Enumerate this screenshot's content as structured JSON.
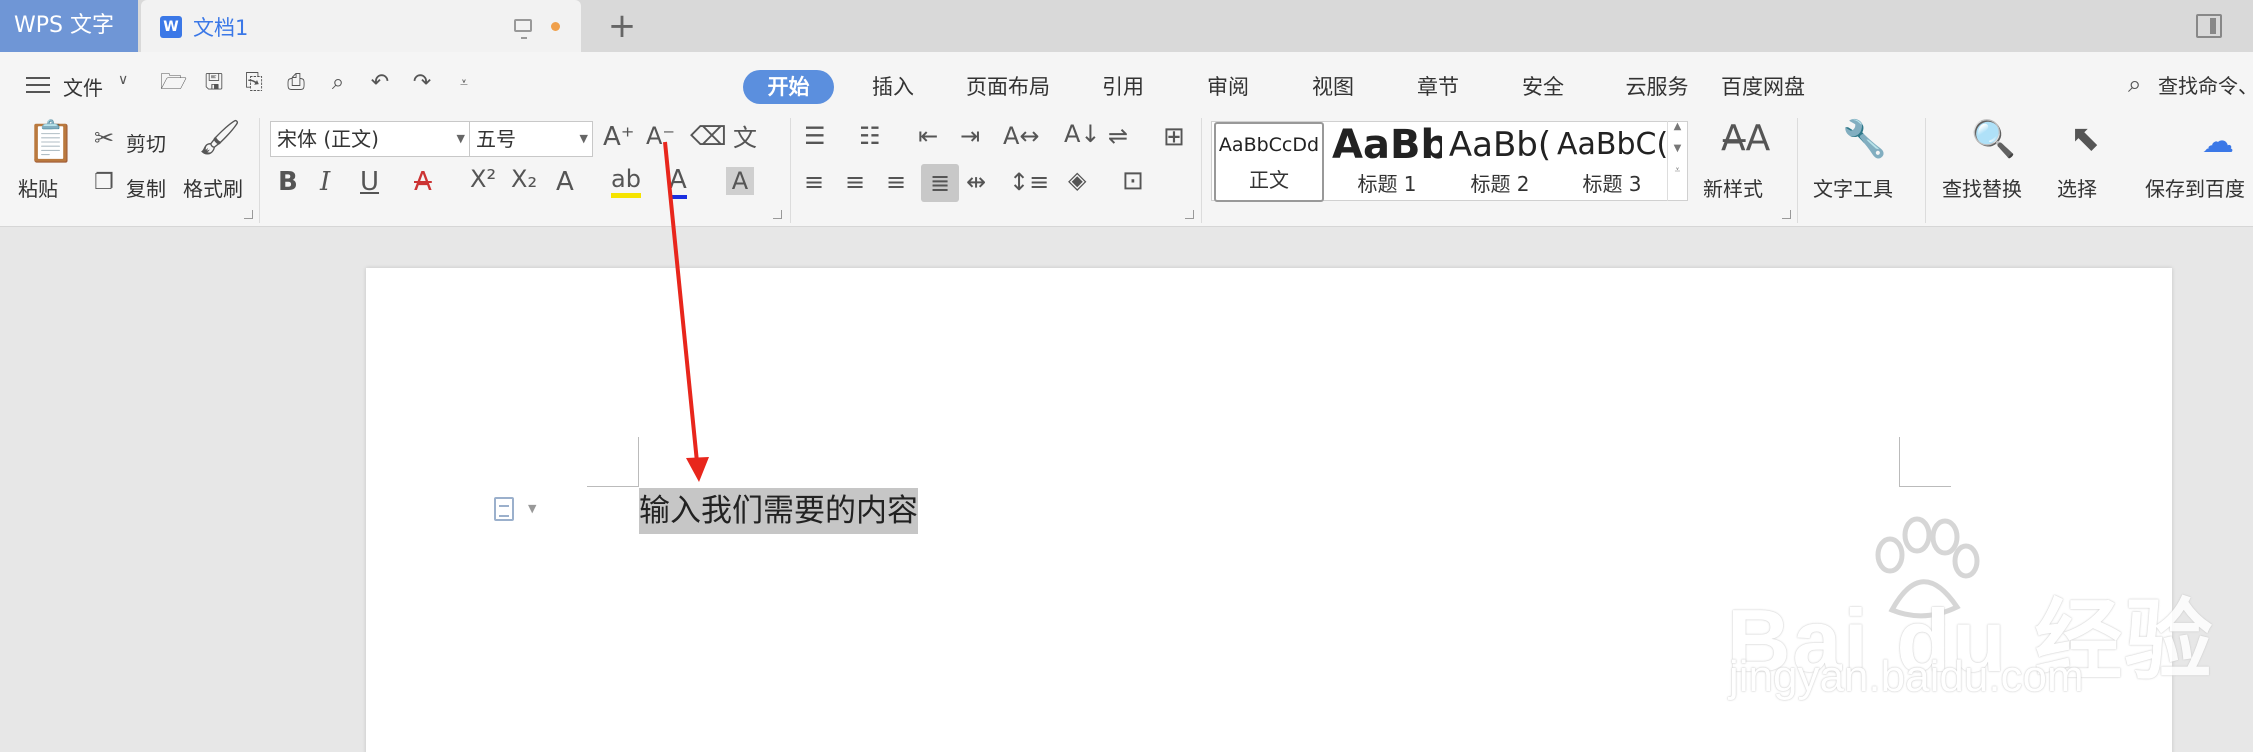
{
  "app": {
    "name": "WPS 文字"
  },
  "document_tab": {
    "title": "文档1",
    "icon": "wps-writer-doc-icon",
    "unsaved_color": "#f0a04b"
  },
  "colors": {
    "accent": "#5b8fde",
    "app_tab": "#6f96d6",
    "arrow": "#e8261c",
    "selection": "#c6c6c6"
  },
  "menu": {
    "file_label": "文件",
    "quick_icons": [
      "open-icon",
      "save-icon",
      "save-as-icon",
      "print-icon",
      "print-preview-icon",
      "undo-icon",
      "redo-icon",
      "customize-icon"
    ]
  },
  "tabs": [
    "开始",
    "插入",
    "页面布局",
    "引用",
    "审阅",
    "视图",
    "章节",
    "安全",
    "云服务",
    "百度网盘"
  ],
  "active_tab": "开始",
  "search_command": "查找命令、",
  "clipboard": {
    "paste": "粘贴",
    "cut": "剪切",
    "copy": "复制",
    "format_painter": "格式刷"
  },
  "font": {
    "name": "宋体 (正文)",
    "size": "五号"
  },
  "styles": [
    {
      "preview": "AaBbCcDd",
      "name": "正文"
    },
    {
      "preview": "AaBb",
      "name": "标题 1"
    },
    {
      "preview": "AaBb(",
      "name": "标题 2"
    },
    {
      "preview": "AaBbC(",
      "name": "标题 3"
    }
  ],
  "right_buttons": {
    "new_style": "新样式",
    "text_tools": "文字工具",
    "find_replace": "查找替换",
    "select": "选择",
    "save_to_baidu": "保存到百度"
  },
  "document": {
    "text": "输入我们需要的内容"
  },
  "watermark": {
    "brand": "Bai du 经验",
    "url": "jingyan.baidu.com"
  }
}
